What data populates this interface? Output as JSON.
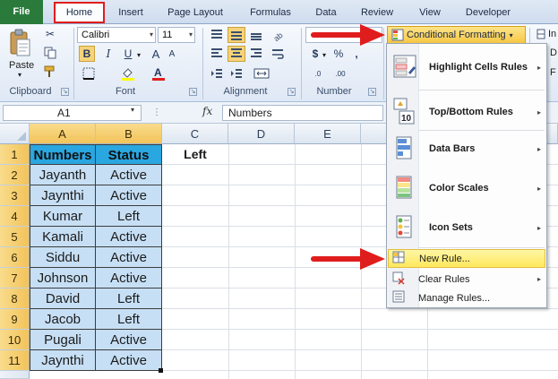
{
  "tabs": {
    "file": "File",
    "home": "Home",
    "insert": "Insert",
    "page_layout": "Page Layout",
    "formulas": "Formulas",
    "data": "Data",
    "review": "Review",
    "view": "View",
    "developer": "Developer"
  },
  "ribbon": {
    "clipboard": {
      "label": "Clipboard",
      "paste": "Paste"
    },
    "font": {
      "label": "Font",
      "name": "Calibri",
      "size": "11",
      "bold": "B",
      "italic": "I",
      "underline": "U",
      "grow": "A",
      "shrink": "A"
    },
    "alignment": {
      "label": "Alignment"
    },
    "number": {
      "label": "Number",
      "currency": "$",
      "percent": "%",
      "comma": ",",
      "dec_inc": ".0",
      "dec_dec": ".00"
    },
    "styles": {
      "conditional_formatting": "Conditional Formatting"
    },
    "cells": {
      "insert_fragment": "In",
      "delete_fragment": "D",
      "format_fragment": "F"
    }
  },
  "formula_bar": {
    "name_box": "A1",
    "fx": "fx",
    "content": "Numbers"
  },
  "grid": {
    "columns": [
      "A",
      "B",
      "C",
      "D",
      "E"
    ],
    "rows": [
      "1",
      "2",
      "3",
      "4",
      "5",
      "6",
      "7",
      "8",
      "9",
      "10",
      "11"
    ],
    "header": {
      "col_a": "Numbers",
      "col_b": "Status"
    },
    "c1_text": "Left",
    "table_rows": [
      {
        "a": "Jayanth",
        "b": "Active"
      },
      {
        "a": "Jaynthi",
        "b": "Active"
      },
      {
        "a": "Kumar",
        "b": "Left"
      },
      {
        "a": "Kamali",
        "b": "Active"
      },
      {
        "a": "Siddu",
        "b": "Active"
      },
      {
        "a": "Johnson",
        "b": "Active"
      },
      {
        "a": "David",
        "b": "Left"
      },
      {
        "a": "Jacob",
        "b": "Left"
      },
      {
        "a": "Pugali",
        "b": "Active"
      },
      {
        "a": "Jaynthi",
        "b": "Active"
      }
    ]
  },
  "cf_menu": {
    "highlight": "Highlight Cells Rules",
    "topbottom": "Top/Bottom Rules",
    "databars": "Data Bars",
    "colorscales": "Color Scales",
    "iconsets": "Icon Sets",
    "new_rule": "New Rule...",
    "clear_rules": "Clear Rules",
    "manage_rules": "Manage Rules..."
  },
  "colors": {
    "accent_red": "#e01d1d",
    "header_fill": "#2aa6e0",
    "data_fill": "#c6dff5",
    "highlight": "#ffe85c"
  }
}
